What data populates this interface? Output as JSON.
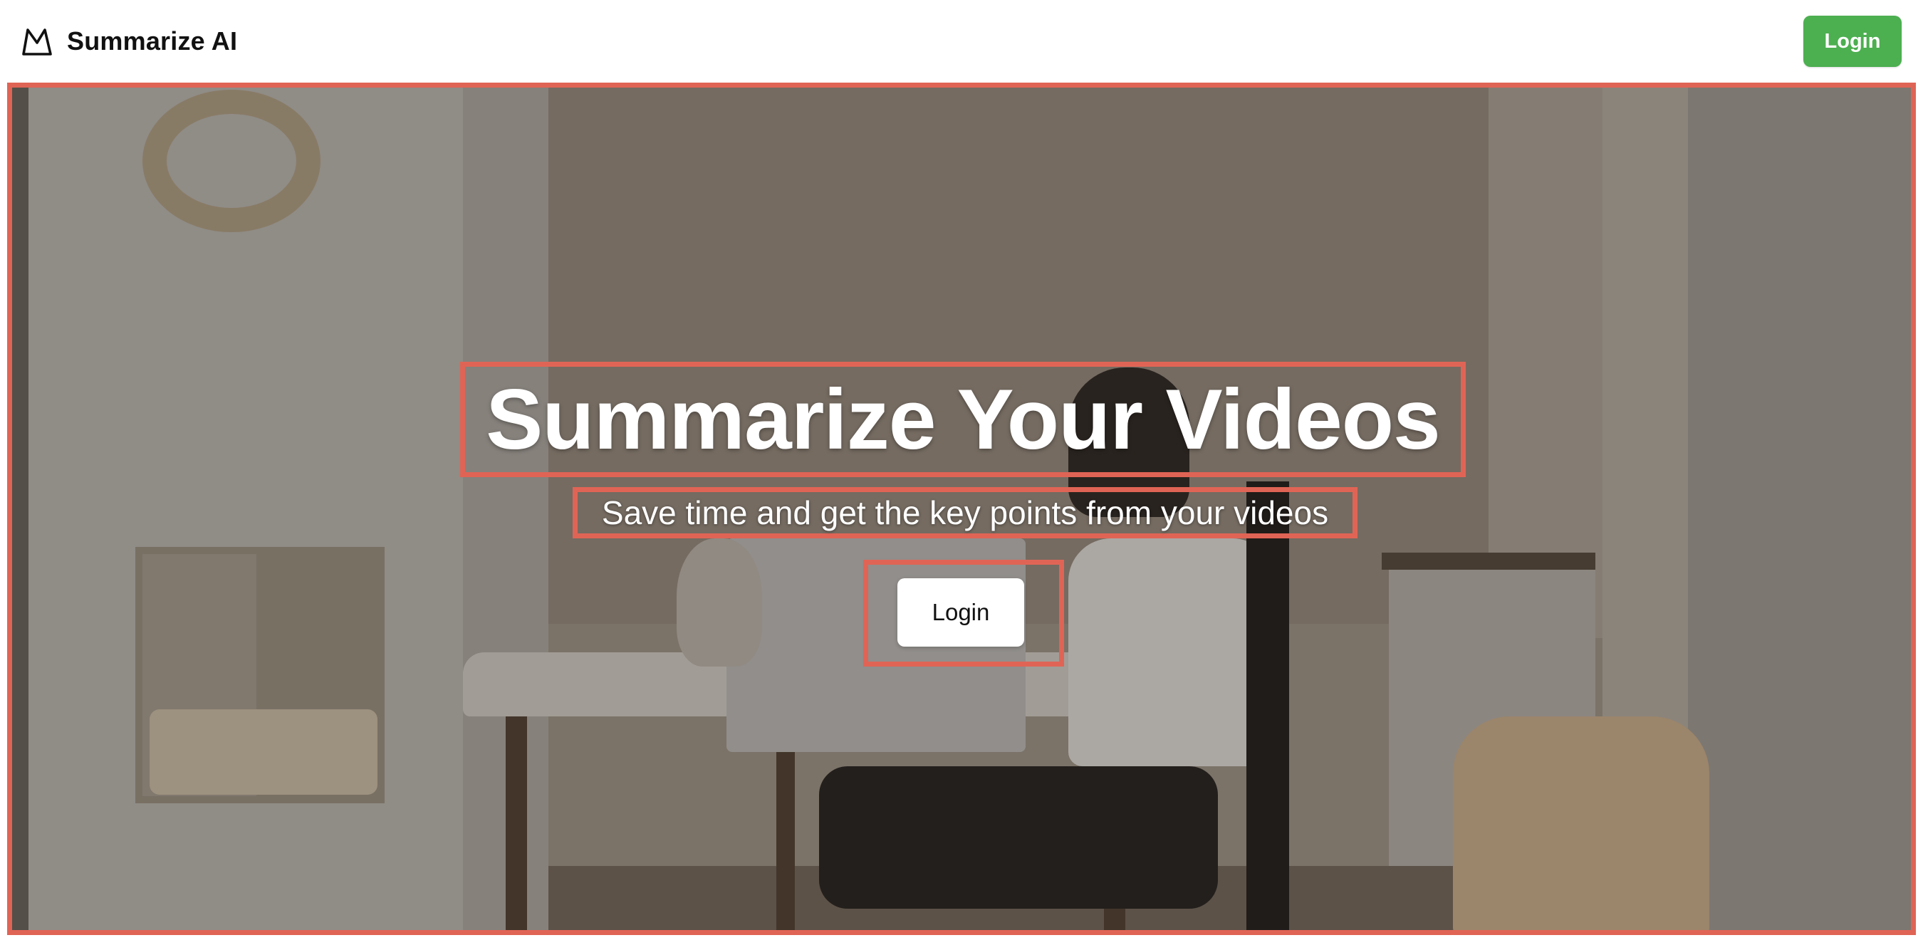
{
  "header": {
    "brand_name": "Summarize AI",
    "login_label": "Login"
  },
  "hero": {
    "title": "Summarize Your Videos",
    "subtitle": "Save time and get the key points from your videos",
    "login_label": "Login"
  },
  "colors": {
    "accent_green": "#4caf50",
    "highlight_frame": "#e06455",
    "button_white": "#ffffff",
    "text_dark": "#111111"
  },
  "icons": {
    "brand_logo": "mountain-logo-icon"
  }
}
